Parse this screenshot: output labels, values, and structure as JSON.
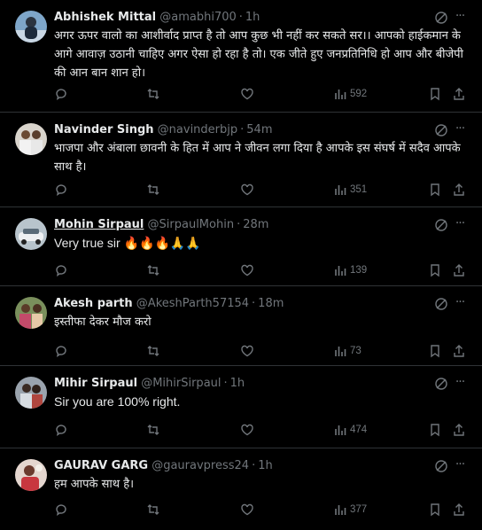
{
  "colors": {
    "background": "#000000",
    "text": "#e7e9ea",
    "muted": "#71767b",
    "divider": "#2f3336"
  },
  "icons": {
    "grok": "grok-icon",
    "more": "more-icon",
    "reply": "reply-icon",
    "retweet": "retweet-icon",
    "like": "heart-icon",
    "views": "views-icon",
    "bookmark": "bookmark-icon",
    "share": "share-icon"
  },
  "more_glyph": "···",
  "separator": "·",
  "tweets": [
    {
      "name": "Abhishek Mittal",
      "handle": "@amabhi700",
      "time": "1h",
      "text": "अगर ऊपर वालो का आशीर्वाद प्राप्त है तो आप कुछ भी नहीं कर सकते सर।। आपको हाईकमान के आगे आवाज़ उठानी चाहिए अगर ऐसा हो रहा है तो। एक जीते हुए जनप्रतिनिधि हो आप और बीजेपी की आन बान शान हो।",
      "views": "592"
    },
    {
      "name": "Navinder Singh",
      "handle": "@navinderbjp",
      "time": "54m",
      "text": "भाजपा और अंबाला छावनी के हित में आप ने जीवन लगा दिया है आपके इस संघर्ष में सदैव आपके साथ है।",
      "views": "351"
    },
    {
      "name": "Mohin Sirpaul",
      "handle": "@SirpaulMohin",
      "time": "28m",
      "text": "Very true sir 🔥🔥🔥🙏🙏",
      "views": "139"
    },
    {
      "name": "Akesh parth",
      "handle": "@AkeshParth57154",
      "time": "18m",
      "text": "इस्तीफा देकर मौज करो",
      "views": "73"
    },
    {
      "name": "Mihir Sirpaul",
      "handle": "@MihirSirpaul",
      "time": "1h",
      "text": "Sir you are 100% right.",
      "views": "474"
    },
    {
      "name": "GAURAV GARG",
      "handle": "@gauravpress24",
      "time": "1h",
      "text": "हम आपके साथ है।",
      "views": "377"
    }
  ]
}
